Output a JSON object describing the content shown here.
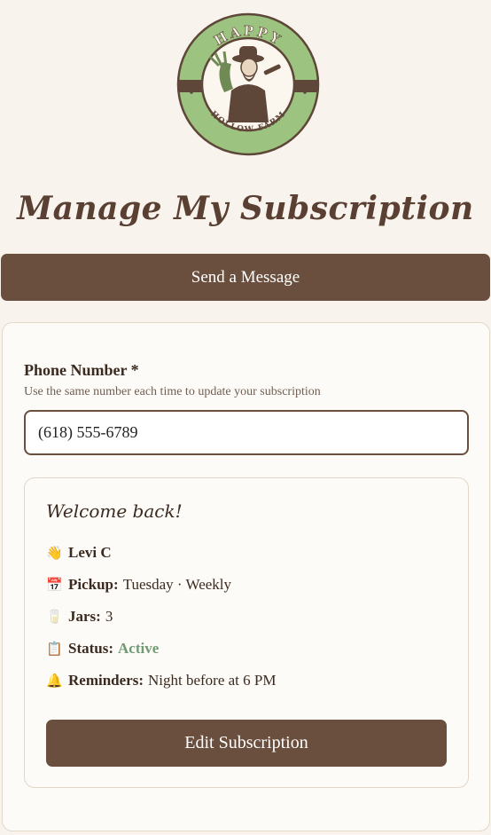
{
  "logo": {
    "top_text": "HAPPY",
    "bottom_text": "HOLLOW FARM",
    "colors": {
      "ring": "#9cc37f",
      "band": "#5e4638",
      "inner": "#fbf6ee"
    }
  },
  "page_title": "Manage My Subscription",
  "message_button_label": "Send a Message",
  "form": {
    "phone_label": "Phone Number *",
    "phone_hint": "Use the same number each time to update your subscription",
    "phone_value": "(618) 555-6789"
  },
  "welcome": {
    "title": "Welcome back!",
    "name_icon": "waving-hand-icon",
    "name": "Levi C",
    "pickup_label": "Pickup:",
    "pickup_value": "Tuesday · Weekly",
    "jars_label": "Jars:",
    "jars_value": "3",
    "status_label": "Status:",
    "status_value": "Active",
    "reminders_label": "Reminders:",
    "reminders_value": "Night before at 6 PM",
    "edit_button_label": "Edit Subscription"
  },
  "colors": {
    "background": "#f8f3ec",
    "button": "#6b4f3e",
    "status_active": "#6f9a72"
  }
}
